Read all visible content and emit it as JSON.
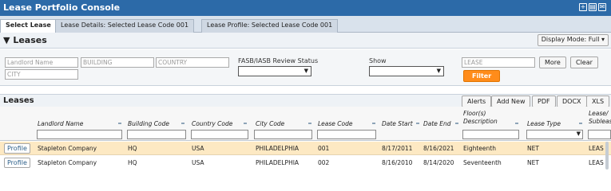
{
  "window": {
    "title": "Lease Portfolio Console"
  },
  "tabs": [
    {
      "label": "Select Lease",
      "active": true
    },
    {
      "label": "Lease Details: Selected Lease Code 001"
    },
    {
      "label": "Lease Profile: Selected Lease Code 001"
    }
  ],
  "section": {
    "title": "Leases",
    "toggle": "▼",
    "display_mode": "Display Mode: Full ▾"
  },
  "filters": {
    "landlord_placeholder": "Landlord Name",
    "building_placeholder": "BUILDING",
    "country_placeholder": "COUNTRY",
    "city_placeholder": "CITY",
    "fasb_label": "FASB/IASB Review Status",
    "show_label": "Show",
    "lease_placeholder": "LEASE",
    "more": "More",
    "clear": "Clear",
    "filter": "Filter"
  },
  "grid": {
    "title": "Leases",
    "buttons": [
      "Alerts",
      "Add New",
      "PDF",
      "DOCX",
      "XLS"
    ],
    "columns": [
      "Landlord Name",
      "Building Code",
      "Country Code",
      "City Code",
      "Lease Code",
      "Date Start",
      "Date End",
      "Floor(s) Description",
      "Lease Type",
      "Lease/ Sublease"
    ],
    "profile_label": "Profile",
    "rows": [
      [
        "Stapleton Company",
        "HQ",
        "USA",
        "PHILADELPHIA",
        "001",
        "8/17/2011",
        "8/16/2021",
        "Eighteenth",
        "NET",
        "LEAS"
      ],
      [
        "Stapleton Company",
        "HQ",
        "USA",
        "PHILADELPHIA",
        "002",
        "8/16/2010",
        "8/14/2020",
        "Seventeenth",
        "NET",
        "LEAS"
      ]
    ]
  }
}
